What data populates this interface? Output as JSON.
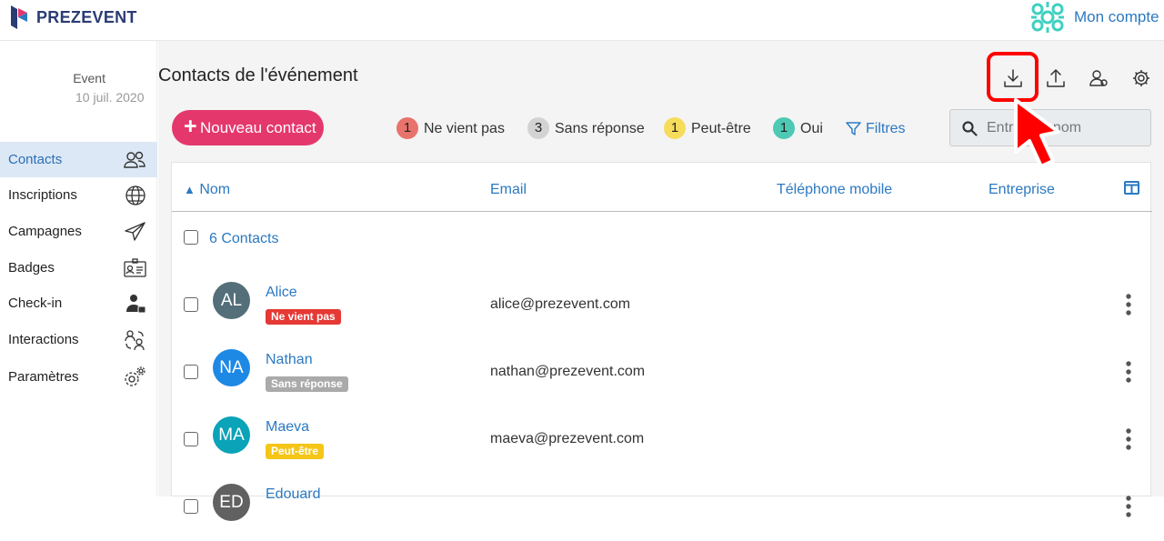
{
  "brand": {
    "name": "PREZEVENT"
  },
  "account": {
    "label": "Mon compte"
  },
  "event": {
    "name": "Event",
    "date": "10 juil. 2020"
  },
  "sidebar": {
    "items": [
      {
        "label": "Contacts",
        "icon": "contacts-icon",
        "active": true
      },
      {
        "label": "Inscriptions",
        "icon": "globe-icon"
      },
      {
        "label": "Campagnes",
        "icon": "paper-plane-icon"
      },
      {
        "label": "Badges",
        "icon": "badge-icon"
      },
      {
        "label": "Check-in",
        "icon": "check-in-user-icon"
      },
      {
        "label": "Interactions",
        "icon": "interactions-icon"
      },
      {
        "label": "Paramètres",
        "icon": "gears-icon"
      }
    ]
  },
  "page": {
    "title": "Contacts de l'événement"
  },
  "toolbar": {
    "icons": [
      "download-icon",
      "upload-icon",
      "manage-users-icon",
      "settings-icon"
    ]
  },
  "actions": {
    "new_contact": "Nouveau contact"
  },
  "stats": [
    {
      "count": "1",
      "label": "Ne vient pas",
      "color": "#e8736c"
    },
    {
      "count": "3",
      "label": "Sans réponse",
      "color": "#d3d3d3"
    },
    {
      "count": "1",
      "label": "Peut-être",
      "color": "#f7dc5c"
    },
    {
      "count": "1",
      "label": "Oui",
      "color": "#4dc9b4"
    }
  ],
  "filters": {
    "label": "Filtres"
  },
  "search": {
    "placeholder": "Entrez un nom"
  },
  "table": {
    "columns": [
      "Nom",
      "Email",
      "Téléphone mobile",
      "Entreprise"
    ],
    "sort_indicator": "▲",
    "count_label": "6 Contacts",
    "rows": [
      {
        "initials": "AL",
        "name": "Alice",
        "status": "Ne vient pas",
        "status_color": "#e53935",
        "email": "alice@prezevent.com",
        "avatar_color": "#546e7a"
      },
      {
        "initials": "NA",
        "name": "Nathan",
        "status": "Sans réponse",
        "status_color": "#aaaaaa",
        "email": "nathan@prezevent.com",
        "avatar_color": "#1e88e5"
      },
      {
        "initials": "MA",
        "name": "Maeva",
        "status": "Peut-être",
        "status_color": "#f5c518",
        "email": "maeva@prezevent.com",
        "avatar_color": "#0aa3b8"
      },
      {
        "initials": "ED",
        "name": "Edouard",
        "status": "",
        "status_color": "",
        "email": "",
        "avatar_color": "#616161"
      }
    ]
  },
  "colors": {
    "accent": "#2b79c2",
    "primary_button": "#e4386d",
    "highlight": "#ff0000"
  }
}
